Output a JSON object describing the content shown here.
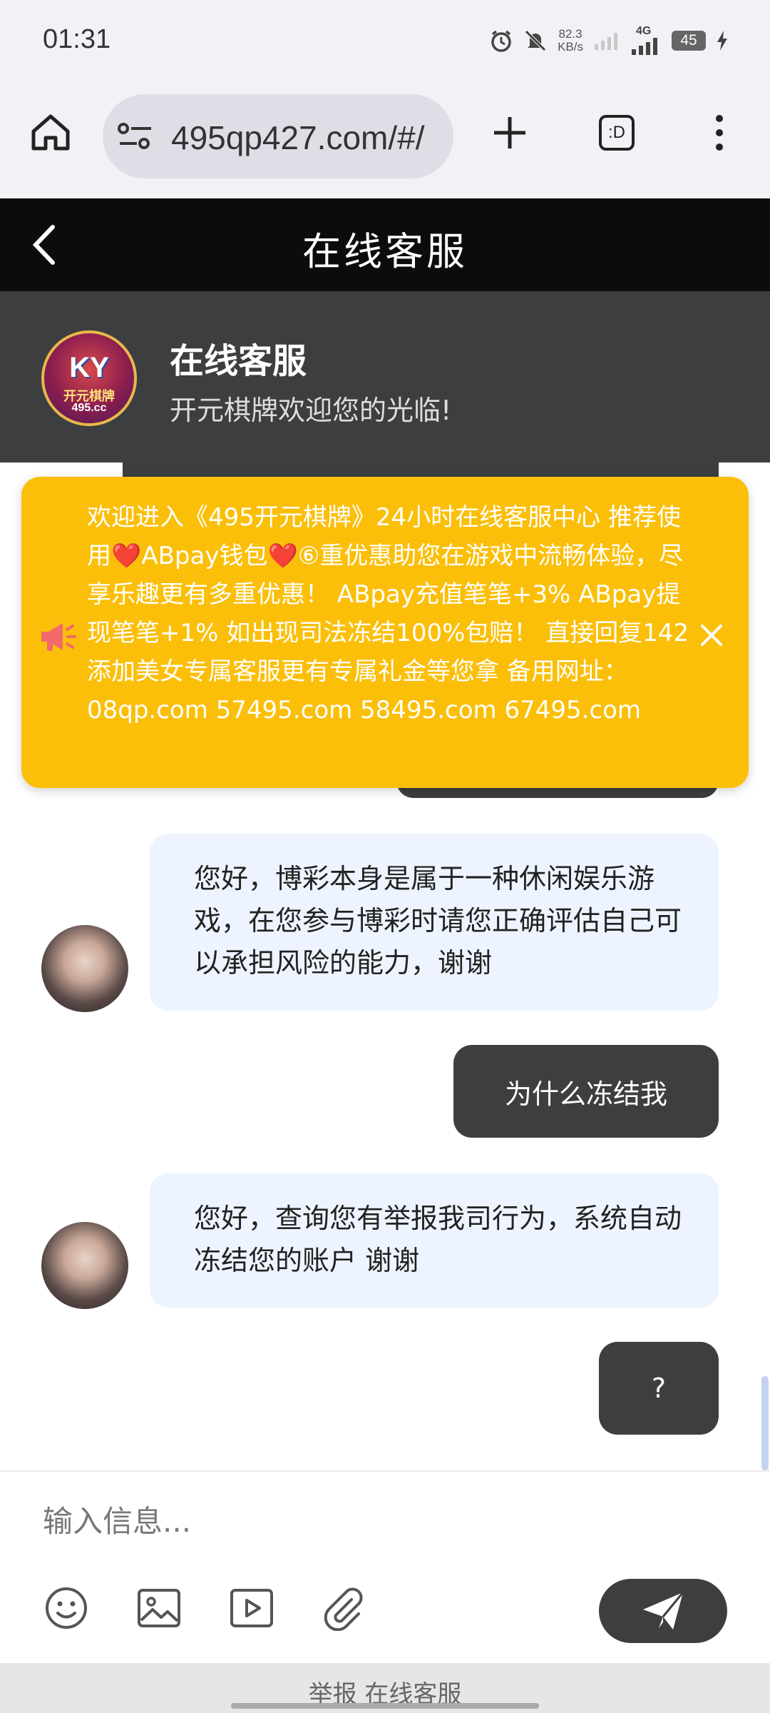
{
  "status_bar": {
    "time": "01:31",
    "net_speed_value": "82.3",
    "net_speed_unit": "KB/s",
    "network": "4G",
    "battery": "45",
    "icons": [
      "alarm-icon",
      "mute-icon",
      "signal-icon",
      "signal-4g-icon",
      "battery-icon",
      "charging-icon"
    ]
  },
  "browser": {
    "url": "495qp427.com/#/",
    "icons": [
      "home-icon",
      "site-settings-icon",
      "new-tab-icon",
      "tabs-icon",
      "menu-icon"
    ],
    "tab_badge": ":D"
  },
  "header": {
    "title": "在线客服"
  },
  "agent": {
    "logo_letters": "KY",
    "logo_subtitle": "开元棋牌",
    "logo_site": "495.cc",
    "name": "在线客服",
    "welcome": "开元棋牌欢迎您的光临!"
  },
  "announcement": {
    "text": "欢迎进入《495开元棋牌》24小时在线客服中心 推荐使用❤️ABpay钱包❤️⑥重优惠助您在游戏中流畅体验，尽享乐趣更有多重优惠！ ABpay充值笔笔+3% ABpay提现笔笔+1% 如出现司法冻结100%包赔！ 直接回复142 添加美女专属客服更有专属礼金等您拿 备用网址：08qp.com 57495.com 58495.com 67495.com"
  },
  "messages": [
    {
      "side": "agent",
      "text": "您好，博彩本身是属于一种休闲娱乐游戏，在您参与博彩时请您正确评估自己可以承担风险的能力，谢谢"
    },
    {
      "side": "user",
      "text": "为什么冻结我"
    },
    {
      "side": "agent",
      "text": "您好，查询您有举报我司行为，系统自动冻结您的账户 谢谢"
    },
    {
      "side": "user",
      "text": "?"
    }
  ],
  "input": {
    "placeholder": "输入信息..."
  },
  "toolbar": {
    "icons": [
      "emoji-icon",
      "image-icon",
      "video-icon",
      "attachment-icon"
    ],
    "send_icon": "send-icon"
  },
  "footer": {
    "text": "举报 在线客服"
  },
  "colors": {
    "header_bg": "#0c0c0c",
    "agent_bar_bg": "#3d3e40",
    "announcement_bg": "#fbbf0a",
    "agent_bubble_bg": "#edf4ff",
    "user_bubble_bg": "#3d3e40"
  }
}
